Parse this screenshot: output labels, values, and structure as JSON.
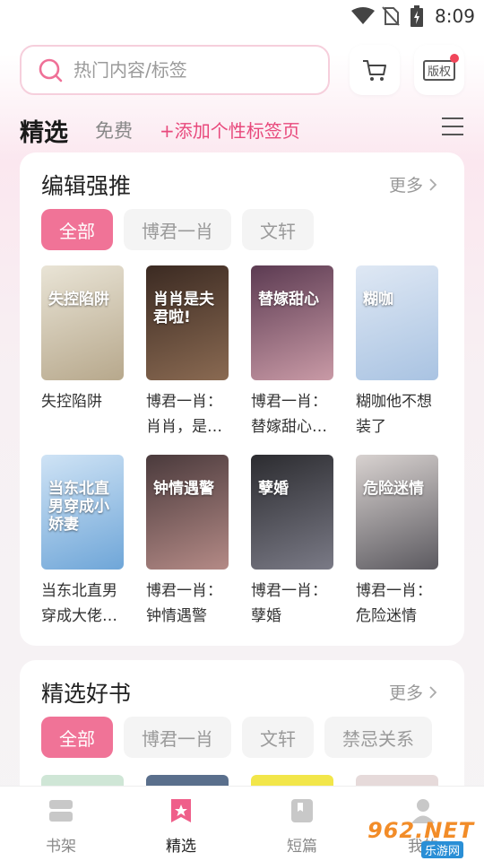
{
  "status_bar": {
    "time": "8:09"
  },
  "search": {
    "placeholder": "热门内容/标签"
  },
  "header": {
    "copyright_label": "版权"
  },
  "tabs": {
    "selected": "精选",
    "free": "免费",
    "add_tag_page": "+添加个性标签页"
  },
  "section_editor": {
    "title": "编辑强推",
    "more": "更多",
    "chips": [
      "全部",
      "博君一肖",
      "文轩"
    ],
    "books": [
      {
        "line1": "失控陷阱",
        "line2": "",
        "cover_text": "失控陷阱",
        "colors": [
          "#e9e4d6",
          "#b7a88c"
        ]
      },
      {
        "line1": "博君一肖：",
        "line2": "肖肖，是…",
        "cover_text": "肖肖是夫君啦!",
        "colors": [
          "#3b2a22",
          "#8a6a52"
        ]
      },
      {
        "line1": "博君一肖：",
        "line2": "替嫁甜心…",
        "cover_text": "替嫁甜心",
        "colors": [
          "#5c3b52",
          "#c99aa6"
        ]
      },
      {
        "line1": "糊咖他不想",
        "line2": "装了",
        "cover_text": "糊咖",
        "colors": [
          "#dfe8f4",
          "#a9c3e2"
        ]
      },
      {
        "line1": "当东北直男",
        "line2": "穿成大佬…",
        "cover_text": "当东北直男穿成小娇妻",
        "colors": [
          "#cfe3f5",
          "#6fa6d8"
        ]
      },
      {
        "line1": "博君一肖：",
        "line2": "钟情遇警",
        "cover_text": "钟情遇警",
        "colors": [
          "#4a3a3c",
          "#b48a86"
        ]
      },
      {
        "line1": "博君一肖：",
        "line2": "孽婚",
        "cover_text": "孽婚",
        "colors": [
          "#2c2c30",
          "#7a7a86"
        ]
      },
      {
        "line1": "博君一肖：",
        "line2": "危险迷情",
        "cover_text": "危险迷情",
        "colors": [
          "#d8d2d0",
          "#5c5a60"
        ]
      }
    ]
  },
  "section_picks": {
    "title": "精选好书",
    "more": "更多",
    "chips": [
      "全部",
      "博君一肖",
      "文轩",
      "禁忌关系"
    ]
  },
  "bottom_nav": {
    "items": [
      "书架",
      "精选",
      "短篇",
      "我的"
    ]
  },
  "watermark": {
    "brand": "962.NET",
    "site": "乐游网"
  },
  "colors": {
    "accent": "#f07397",
    "link": "#e8497c"
  }
}
